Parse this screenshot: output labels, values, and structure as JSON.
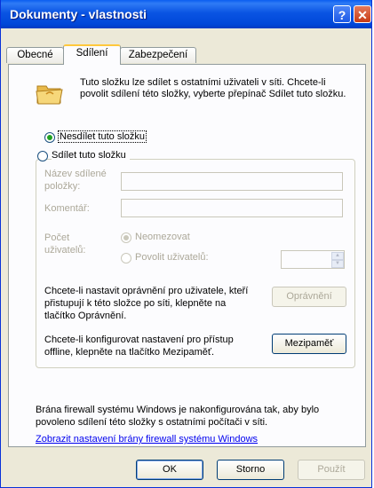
{
  "window": {
    "title": "Dokumenty - vlastnosti",
    "help_label": "?",
    "close_label": "✕"
  },
  "tabs": [
    {
      "label": "Obecné"
    },
    {
      "label": "Sdílení"
    },
    {
      "label": "Zabezpečení"
    }
  ],
  "sharing": {
    "intro": "Tuto složku lze sdílet s ostatními uživateli v síti. Chcete-li povolit sdílení této složky, vyberte přepínač Sdílet tuto složku.",
    "option_no_share": "Nesdílet tuto složku",
    "option_share": "Sdílet tuto složku",
    "share_name_label": "Název sdílené položky:",
    "share_name_value": "",
    "comment_label": "Komentář:",
    "comment_value": "",
    "user_limit_label": "Počet uživatelů:",
    "option_unlimited": "Neomezovat",
    "option_allow_users": "Povolit uživatelů:",
    "allow_users_value": "",
    "permissions_text": "Chcete-li nastavit oprávnění pro uživatele, kteří přistupují k této složce po síti, klepněte na tlačítko Oprávnění.",
    "permissions_button": "Oprávnění",
    "caching_text": "Chcete-li konfigurovat nastavení pro přístup offline, klepněte na tlačítko Mezipaměť.",
    "caching_button": "Mezipaměť",
    "firewall_text": "Brána firewall systému Windows je nakonfigurována tak, aby bylo povoleno sdílení této složky s ostatními počítači v síti.",
    "firewall_link": "Zobrazit nastavení brány firewall systému Windows"
  },
  "footer": {
    "ok": "OK",
    "cancel": "Storno",
    "apply": "Použít"
  }
}
